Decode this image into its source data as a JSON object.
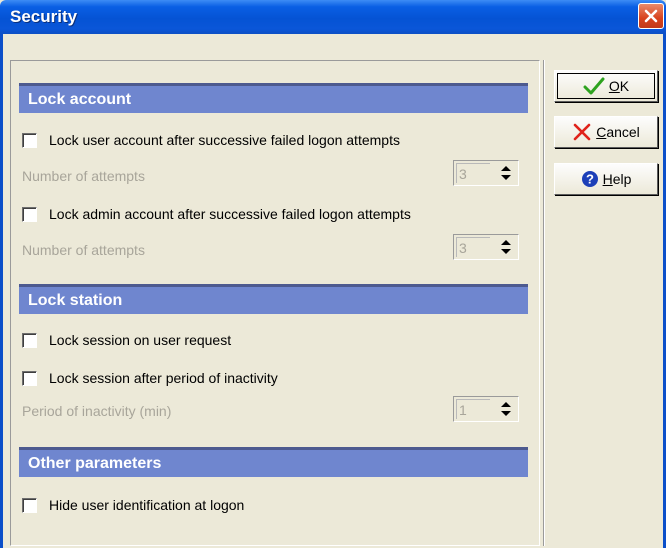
{
  "window": {
    "title": "Security"
  },
  "buttons": {
    "ok": {
      "mnemonic": "O",
      "rest": "K"
    },
    "cancel": {
      "mnemonic": "C",
      "rest": "ancel"
    },
    "help": {
      "mnemonic": "H",
      "rest": "elp"
    }
  },
  "sections": {
    "lock_account": {
      "header": "Lock account",
      "user_lock_label": "Lock user account after successive failed logon attempts",
      "user_attempts_label": "Number of attempts",
      "user_attempts_value": "3",
      "admin_lock_label": "Lock admin account after successive failed logon attempts",
      "admin_attempts_label": "Number of attempts",
      "admin_attempts_value": "3"
    },
    "lock_station": {
      "header": "Lock station",
      "user_request_label": "Lock session on user request",
      "inactivity_label": "Lock session after period of inactivity",
      "period_label": "Period of inactivity (min)",
      "period_value": "1"
    },
    "other": {
      "header": "Other parameters",
      "hide_user_label": "Hide user identification at logon"
    }
  },
  "colors": {
    "section_header": "#6f86cf",
    "title_bar": "#0553d4",
    "disabled_text": "#a8a59a"
  },
  "checkboxes": {
    "user_lock": false,
    "admin_lock": false,
    "user_request": false,
    "inactivity": false,
    "hide_user": false
  }
}
